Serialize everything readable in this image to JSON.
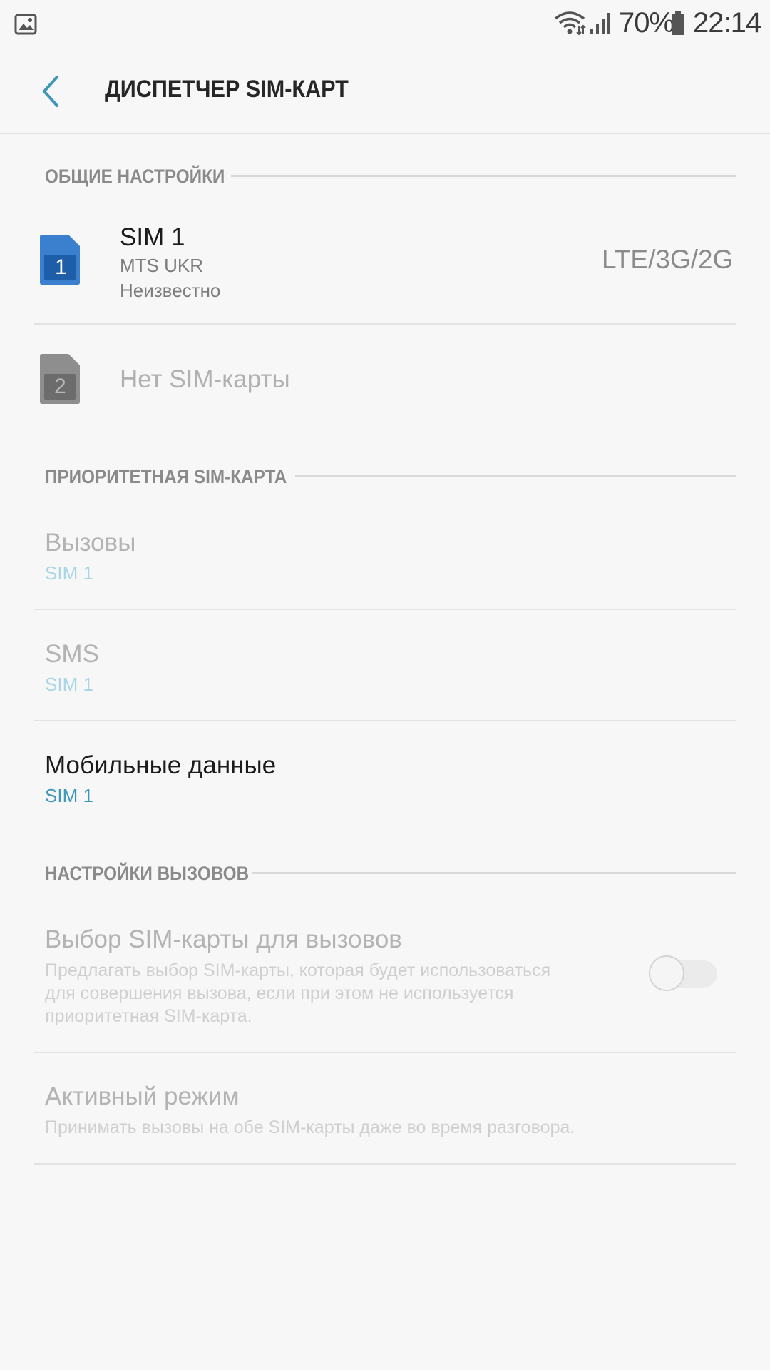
{
  "status_bar": {
    "battery_percent": "70%",
    "clock": "22:14",
    "icons": [
      "gallery-icon",
      "wifi-icon",
      "signal-icon",
      "battery-icon"
    ]
  },
  "app_bar": {
    "title": "ДИСПЕТЧЕР SIM-КАРТ",
    "back_icon": "chevron-left-icon"
  },
  "sections": {
    "general": "ОБЩИЕ НАСТРОЙКИ",
    "priority": "ПРИОРИТЕТНАЯ SIM-КАРТА",
    "calls": "НАСТРОЙКИ ВЫЗОВОВ"
  },
  "sim1": {
    "icon_number": "1",
    "title": "SIM 1",
    "operator": "MTS UKR",
    "status": "Неизвестно",
    "network": "LTE/3G/2G"
  },
  "sim2": {
    "icon_number": "2",
    "title": "Нет SIM-карты"
  },
  "priority": {
    "calls": {
      "title": "Вызовы",
      "value": "SIM 1"
    },
    "sms": {
      "title": "SMS",
      "value": "SIM 1"
    },
    "mobile_data": {
      "title": "Мобильные данные",
      "value": "SIM 1"
    }
  },
  "call_settings": {
    "sim_choice": {
      "title": "Выбор SIM-карты для вызовов",
      "desc_line1": "Предлагать выбор SIM-карты, которая будет использоваться",
      "desc_line2": "для совершения вызова, если при этом не используется",
      "desc_line3": "приоритетная SIM-карта.",
      "toggle_on": false
    },
    "active_mode": {
      "title": "Активный режим",
      "desc": "Принимать вызовы на обе SIM-карты даже во время разговора."
    }
  },
  "colors": {
    "accent": "#3e97b8",
    "sim1_blue": "#3b7fcf",
    "sim2_gray": "#8e8e8e",
    "background": "#f7f7f7"
  }
}
